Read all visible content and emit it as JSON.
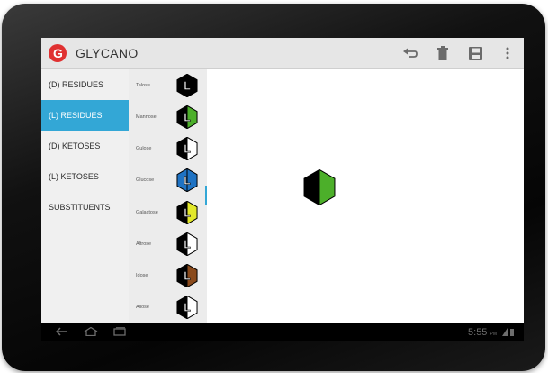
{
  "app": {
    "title": "GLYCANO",
    "logo_letter": "G"
  },
  "actions": [
    {
      "name": "undo-icon",
      "glyph": "↺"
    },
    {
      "name": "trash-icon",
      "glyph": "🗑"
    },
    {
      "name": "save-icon",
      "glyph": "💾"
    },
    {
      "name": "overflow-menu-icon",
      "glyph": "⋮"
    }
  ],
  "categories": [
    {
      "label": "(D) RESIDUES",
      "active": false
    },
    {
      "label": "(L) RESIDUES",
      "active": true
    },
    {
      "label": "(D) KETOSES",
      "active": false
    },
    {
      "label": "(L) KETOSES",
      "active": false
    },
    {
      "label": "SUBSTITUENTS",
      "active": false
    }
  ],
  "residues": [
    {
      "label": "Talose",
      "left_color": "#000000",
      "right_color": "#000000",
      "letter": "L"
    },
    {
      "label": "Mannose",
      "left_color": "#000000",
      "right_color": "#4caf2a",
      "letter": "L"
    },
    {
      "label": "Gulose",
      "left_color": "#000000",
      "right_color": "#ffffff",
      "letter": "L"
    },
    {
      "label": "Glucose",
      "left_color": "#1f73c4",
      "right_color": "#1f73c4",
      "letter": "L"
    },
    {
      "label": "Galactose",
      "left_color": "#000000",
      "right_color": "#e2e82a",
      "letter": "L"
    },
    {
      "label": "Altrose",
      "left_color": "#000000",
      "right_color": "#ffffff",
      "letter": "L"
    },
    {
      "label": "Idose",
      "left_color": "#000000",
      "right_color": "#8a4a1c",
      "letter": "L"
    },
    {
      "label": "Allose",
      "left_color": "#000000",
      "right_color": "#ffffff",
      "letter": "L"
    }
  ],
  "canvas_residue": {
    "left_color": "#000000",
    "right_color": "#4caf2a"
  },
  "colors": {
    "accent": "#33a7d6",
    "logo": "#e03131"
  },
  "navbar": {
    "clock": "5:55",
    "clock_suffix": "PM"
  }
}
